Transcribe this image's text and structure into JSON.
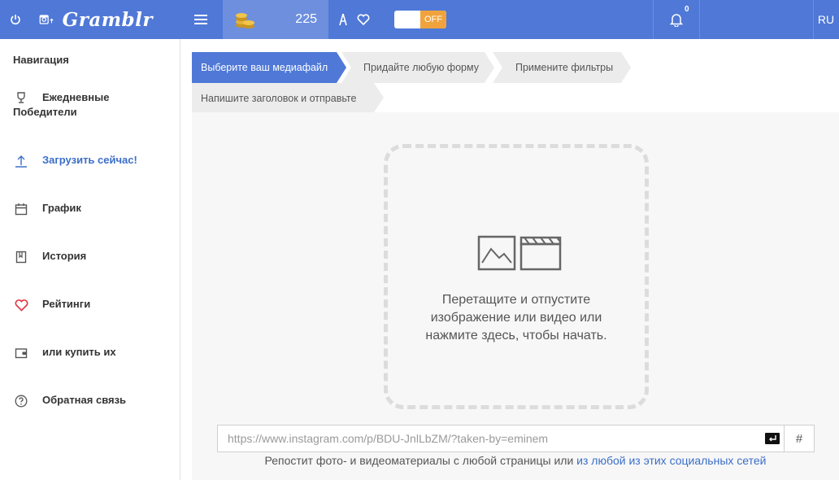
{
  "topbar": {
    "logo_text": "Gramblr",
    "coins": "225",
    "toggle_label": "OFF",
    "notifications_count": "0",
    "language": "RU"
  },
  "sidebar": {
    "title": "Навигация",
    "items": [
      {
        "label": "Ежедневные Победители",
        "icon": "trophy-icon"
      },
      {
        "label": "Загрузить сейчас!",
        "icon": "upload-icon",
        "active": true
      },
      {
        "label": "График",
        "icon": "calendar-icon"
      },
      {
        "label": "История",
        "icon": "book-icon"
      },
      {
        "label": "Рейтинги",
        "icon": "heart-icon"
      },
      {
        "label": "или купить их",
        "icon": "wallet-icon"
      },
      {
        "label": "Обратная связь",
        "icon": "help-icon"
      }
    ]
  },
  "steps": [
    "Выберите ваш медиафайл",
    "Придайте любую форму",
    "Примените фильтры",
    "Напишите заголовок и отправьте"
  ],
  "dropzone": {
    "text": "Перетащите и отпустите изображение или видео или нажмите здесь, чтобы начать."
  },
  "url": {
    "placeholder": "https://www.instagram.com/p/BDU-JnlLbZM/?taken-by=eminem",
    "hash_label": "#"
  },
  "hint": {
    "text": "Репостит фото- и видеоматериалы с любой страницы или",
    "link": "из любой из этих социальных сетей"
  },
  "colors": {
    "topbar": "#4f78d7",
    "accent": "#3b6ec9",
    "toggle_off": "#f0a33c",
    "heart": "#e0323c"
  }
}
